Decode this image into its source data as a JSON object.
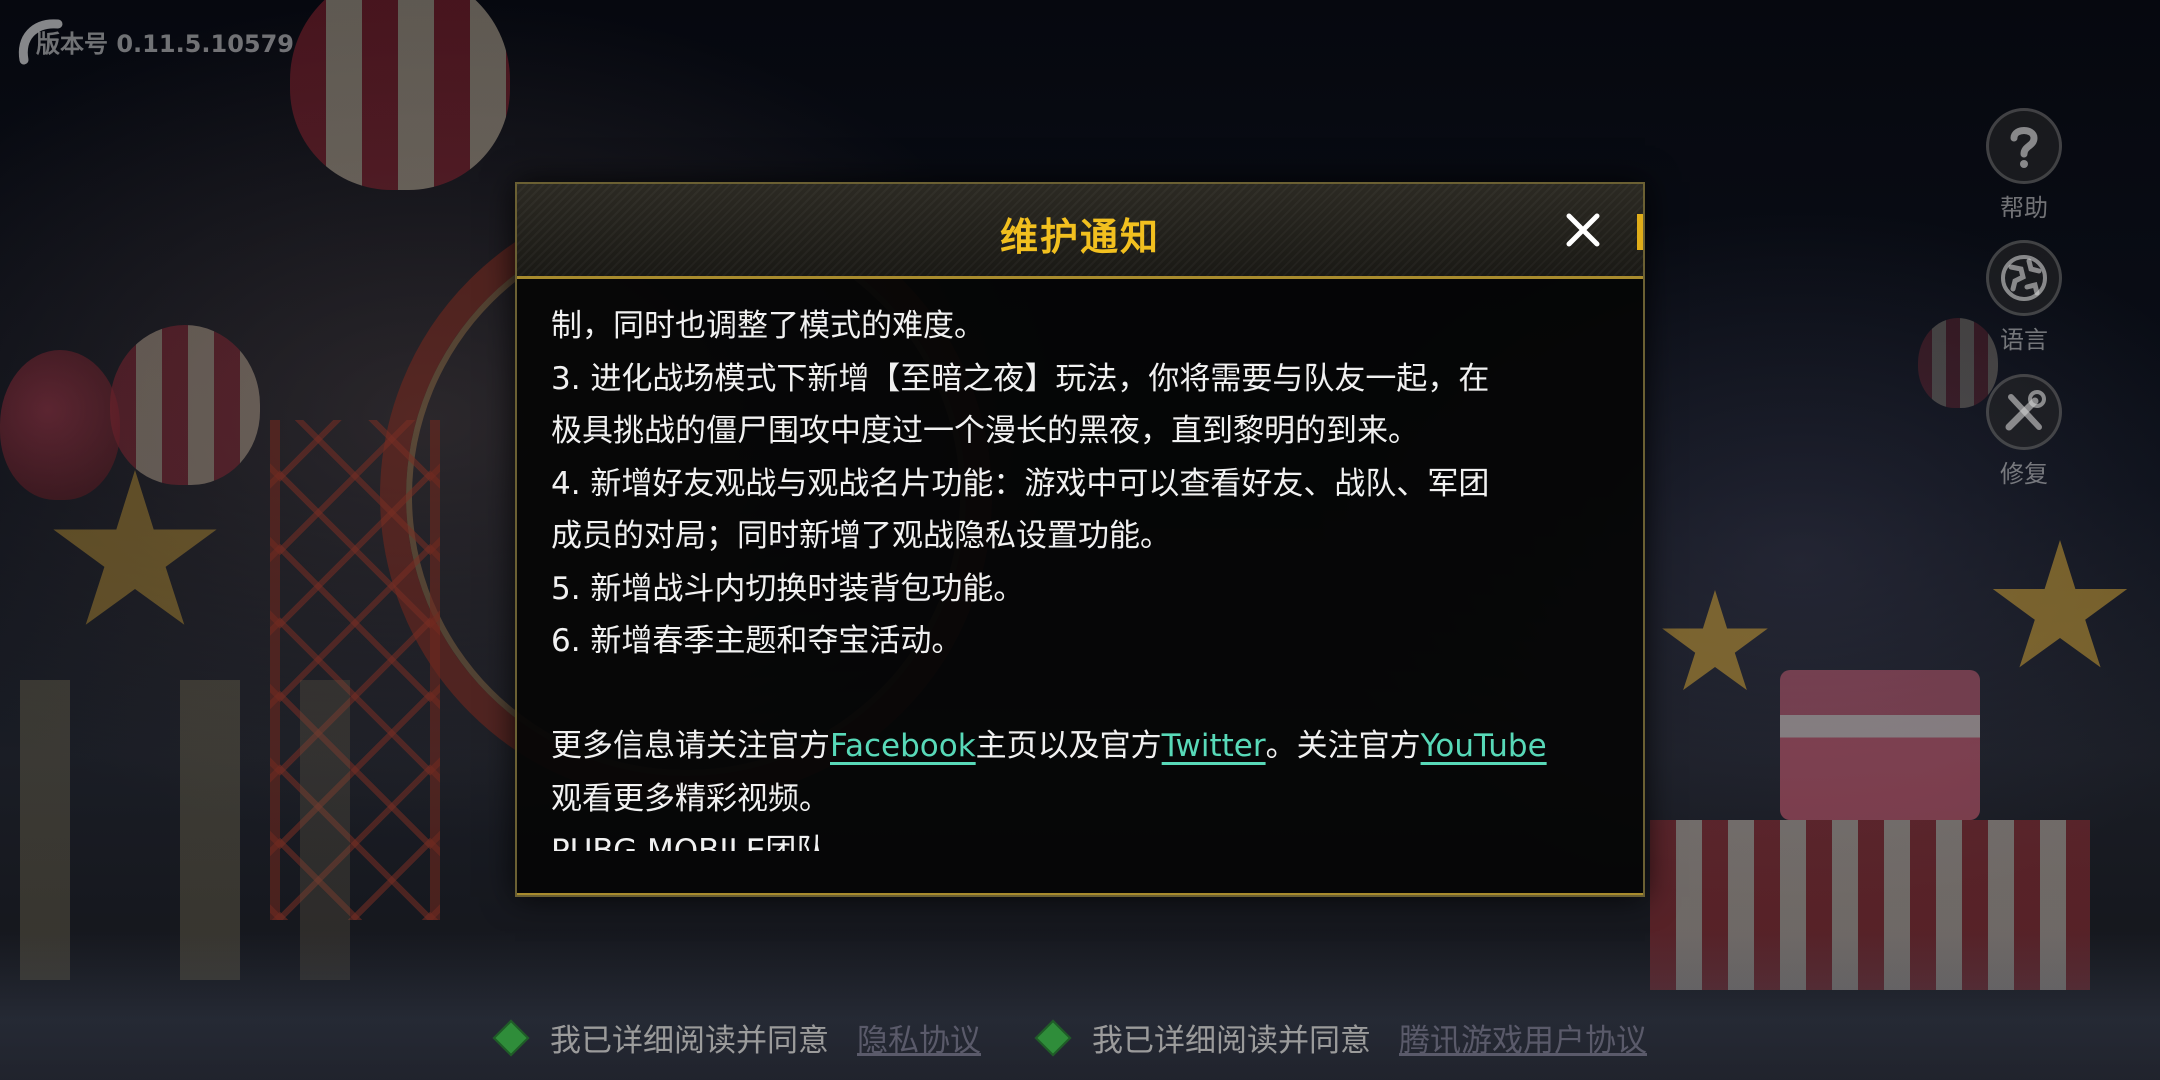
{
  "version": {
    "label": "版本号 0.11.5.10579"
  },
  "side_buttons": {
    "help": {
      "label": "帮助",
      "icon": "question-icon"
    },
    "language": {
      "label": "语言",
      "icon": "globe-icon"
    },
    "repair": {
      "label": "修复",
      "icon": "wrench-screwdriver-icon"
    }
  },
  "dialog": {
    "title": "维护通知",
    "close_icon": "close-icon",
    "lines": [
      "制，同时也调整了模式的难度。",
      "3. 进化战场模式下新增【至暗之夜】玩法，你将需要与队友一起，在",
      "极具挑战的僵尸围攻中度过一个漫长的黑夜，直到黎明的到来。",
      "4. 新增好友观战与观战名片功能：游戏中可以查看好友、战队、军团",
      "成员的对局；同时新增了观战隐私设置功能。",
      "5. 新增战斗内切换时装背包功能。",
      "6. 新增春季主题和夺宝活动。"
    ],
    "follow": {
      "prefix": "更多信息请关注官方",
      "facebook": "Facebook",
      "middle": "主页以及官方",
      "twitter": "Twitter",
      "middle2": "。关注官方",
      "youtube": "YouTube",
      "suffix": "观看更多精彩视频。"
    },
    "signature": "PUBG MOBILE团队"
  },
  "agreements": [
    {
      "text": "我已详细阅读并同意",
      "link": "隐私协议"
    },
    {
      "text": "我已详细阅读并同意",
      "link": "腾讯游戏用户协议"
    }
  ],
  "colors": {
    "title": "#f2c01f",
    "link": "#58d9b8",
    "checkbox": "#2f8d3a"
  }
}
